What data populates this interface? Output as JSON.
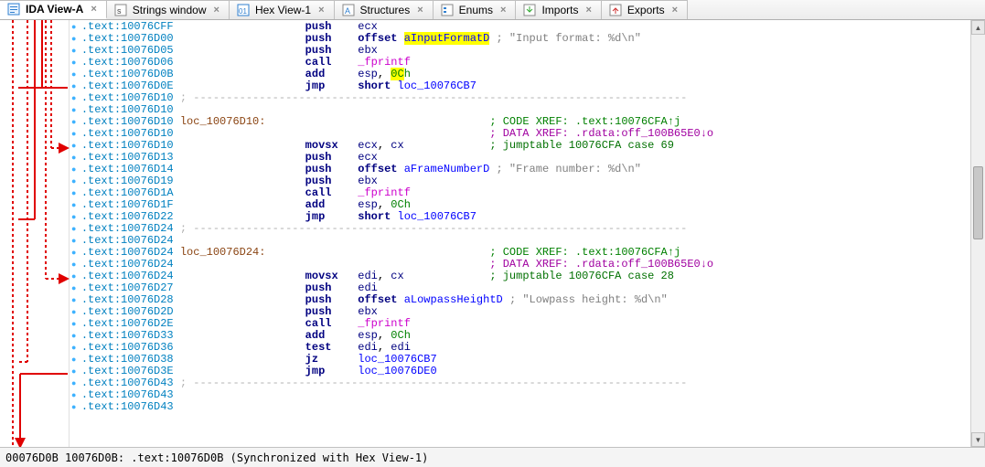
{
  "tabs": [
    {
      "label": "IDA View-A",
      "icon": "ida"
    },
    {
      "label": "Strings window",
      "icon": "str"
    },
    {
      "label": "Hex View-1",
      "icon": "hex"
    },
    {
      "label": "Structures",
      "icon": "struct"
    },
    {
      "label": "Enums",
      "icon": "enum"
    },
    {
      "label": "Imports",
      "icon": "imp"
    },
    {
      "label": "Exports",
      "icon": "exp"
    }
  ],
  "active_tab": 0,
  "cursor_highlight_text": "0C",
  "highlighted_operand_text": "aInputFormatD",
  "status": "00076D0B 10076D0B: .text:10076D0B (Synchronized with Hex View-1)",
  "dash_line": "; ---------------------------------------------------------------------------",
  "lines": [
    {
      "addr": ".text:10076CFF",
      "mnem": "push",
      "ops": [
        {
          "t": "reg",
          "v": "ecx"
        }
      ]
    },
    {
      "addr": ".text:10076D00",
      "mnem": "push",
      "ops": [
        {
          "t": "kw",
          "v": "offset "
        },
        {
          "t": "hlident",
          "v": "aInputFormatD"
        }
      ],
      "cmt": "; \"Input format: %d\\n\""
    },
    {
      "addr": ".text:10076D05",
      "mnem": "push",
      "ops": [
        {
          "t": "reg",
          "v": "ebx"
        }
      ]
    },
    {
      "addr": ".text:10076D06",
      "mnem": "call",
      "ops": [
        {
          "t": "ext",
          "v": "_fprintf"
        }
      ]
    },
    {
      "addr": ".text:10076D0B",
      "mnem": "add",
      "ops": [
        {
          "t": "reg",
          "v": "esp"
        },
        {
          "t": "plain",
          "v": ", "
        },
        {
          "t": "numhl",
          "v": "0C"
        },
        {
          "t": "num",
          "v": "h"
        }
      ]
    },
    {
      "addr": ".text:10076D0E",
      "mnem": "jmp",
      "ops": [
        {
          "t": "kw",
          "v": "short "
        },
        {
          "t": "ident",
          "v": "loc_10076CB7"
        }
      ]
    },
    {
      "addr": ".text:10076D10",
      "dash": true
    },
    {
      "addr": ".text:10076D10",
      "blank": true
    },
    {
      "addr": ".text:10076D10",
      "label": "loc_10076D10:",
      "xref1": "; CODE XREF: .text:10076CFA↑j"
    },
    {
      "addr": ".text:10076D10",
      "xref2only": "; DATA XREF: .rdata:off_100B65E0↓o"
    },
    {
      "addr": ".text:10076D10",
      "mnem": "movsx",
      "ops": [
        {
          "t": "reg",
          "v": "ecx"
        },
        {
          "t": "plain",
          "v": ", "
        },
        {
          "t": "reg",
          "v": "cx"
        }
      ],
      "cmtg": "; jumptable 10076CFA case 69"
    },
    {
      "addr": ".text:10076D13",
      "mnem": "push",
      "ops": [
        {
          "t": "reg",
          "v": "ecx"
        }
      ]
    },
    {
      "addr": ".text:10076D14",
      "mnem": "push",
      "ops": [
        {
          "t": "kw",
          "v": "offset "
        },
        {
          "t": "ident",
          "v": "aFrameNumberD"
        }
      ],
      "cmt": "; \"Frame number: %d\\n\""
    },
    {
      "addr": ".text:10076D19",
      "mnem": "push",
      "ops": [
        {
          "t": "reg",
          "v": "ebx"
        }
      ]
    },
    {
      "addr": ".text:10076D1A",
      "mnem": "call",
      "ops": [
        {
          "t": "ext",
          "v": "_fprintf"
        }
      ]
    },
    {
      "addr": ".text:10076D1F",
      "mnem": "add",
      "ops": [
        {
          "t": "reg",
          "v": "esp"
        },
        {
          "t": "plain",
          "v": ", "
        },
        {
          "t": "num",
          "v": "0Ch"
        }
      ]
    },
    {
      "addr": ".text:10076D22",
      "mnem": "jmp",
      "ops": [
        {
          "t": "kw",
          "v": "short "
        },
        {
          "t": "ident",
          "v": "loc_10076CB7"
        }
      ]
    },
    {
      "addr": ".text:10076D24",
      "dash": true
    },
    {
      "addr": ".text:10076D24",
      "blank": true
    },
    {
      "addr": ".text:10076D24",
      "label": "loc_10076D24:",
      "xref1": "; CODE XREF: .text:10076CFA↑j"
    },
    {
      "addr": ".text:10076D24",
      "xref2only": "; DATA XREF: .rdata:off_100B65E0↓o"
    },
    {
      "addr": ".text:10076D24",
      "mnem": "movsx",
      "ops": [
        {
          "t": "reg",
          "v": "edi"
        },
        {
          "t": "plain",
          "v": ", "
        },
        {
          "t": "reg",
          "v": "cx"
        }
      ],
      "cmtg": "; jumptable 10076CFA case 28"
    },
    {
      "addr": ".text:10076D27",
      "mnem": "push",
      "ops": [
        {
          "t": "reg",
          "v": "edi"
        }
      ]
    },
    {
      "addr": ".text:10076D28",
      "mnem": "push",
      "ops": [
        {
          "t": "kw",
          "v": "offset "
        },
        {
          "t": "ident",
          "v": "aLowpassHeightD"
        }
      ],
      "cmt": "; \"Lowpass height: %d\\n\""
    },
    {
      "addr": ".text:10076D2D",
      "mnem": "push",
      "ops": [
        {
          "t": "reg",
          "v": "ebx"
        }
      ]
    },
    {
      "addr": ".text:10076D2E",
      "mnem": "call",
      "ops": [
        {
          "t": "ext",
          "v": "_fprintf"
        }
      ]
    },
    {
      "addr": ".text:10076D33",
      "mnem": "add",
      "ops": [
        {
          "t": "reg",
          "v": "esp"
        },
        {
          "t": "plain",
          "v": ", "
        },
        {
          "t": "num",
          "v": "0Ch"
        }
      ]
    },
    {
      "addr": ".text:10076D36",
      "mnem": "test",
      "ops": [
        {
          "t": "reg",
          "v": "edi"
        },
        {
          "t": "plain",
          "v": ", "
        },
        {
          "t": "reg",
          "v": "edi"
        }
      ]
    },
    {
      "addr": ".text:10076D38",
      "mnem": "jz",
      "ops": [
        {
          "t": "ident",
          "v": "loc_10076CB7"
        }
      ]
    },
    {
      "addr": ".text:10076D3E",
      "mnem": "jmp",
      "ops": [
        {
          "t": "ident",
          "v": "loc_10076DE0"
        }
      ]
    },
    {
      "addr": ".text:10076D43",
      "dash": true
    },
    {
      "addr": ".text:10076D43",
      "blank": true
    },
    {
      "addr": ".text:10076D43",
      "blank": true
    }
  ]
}
